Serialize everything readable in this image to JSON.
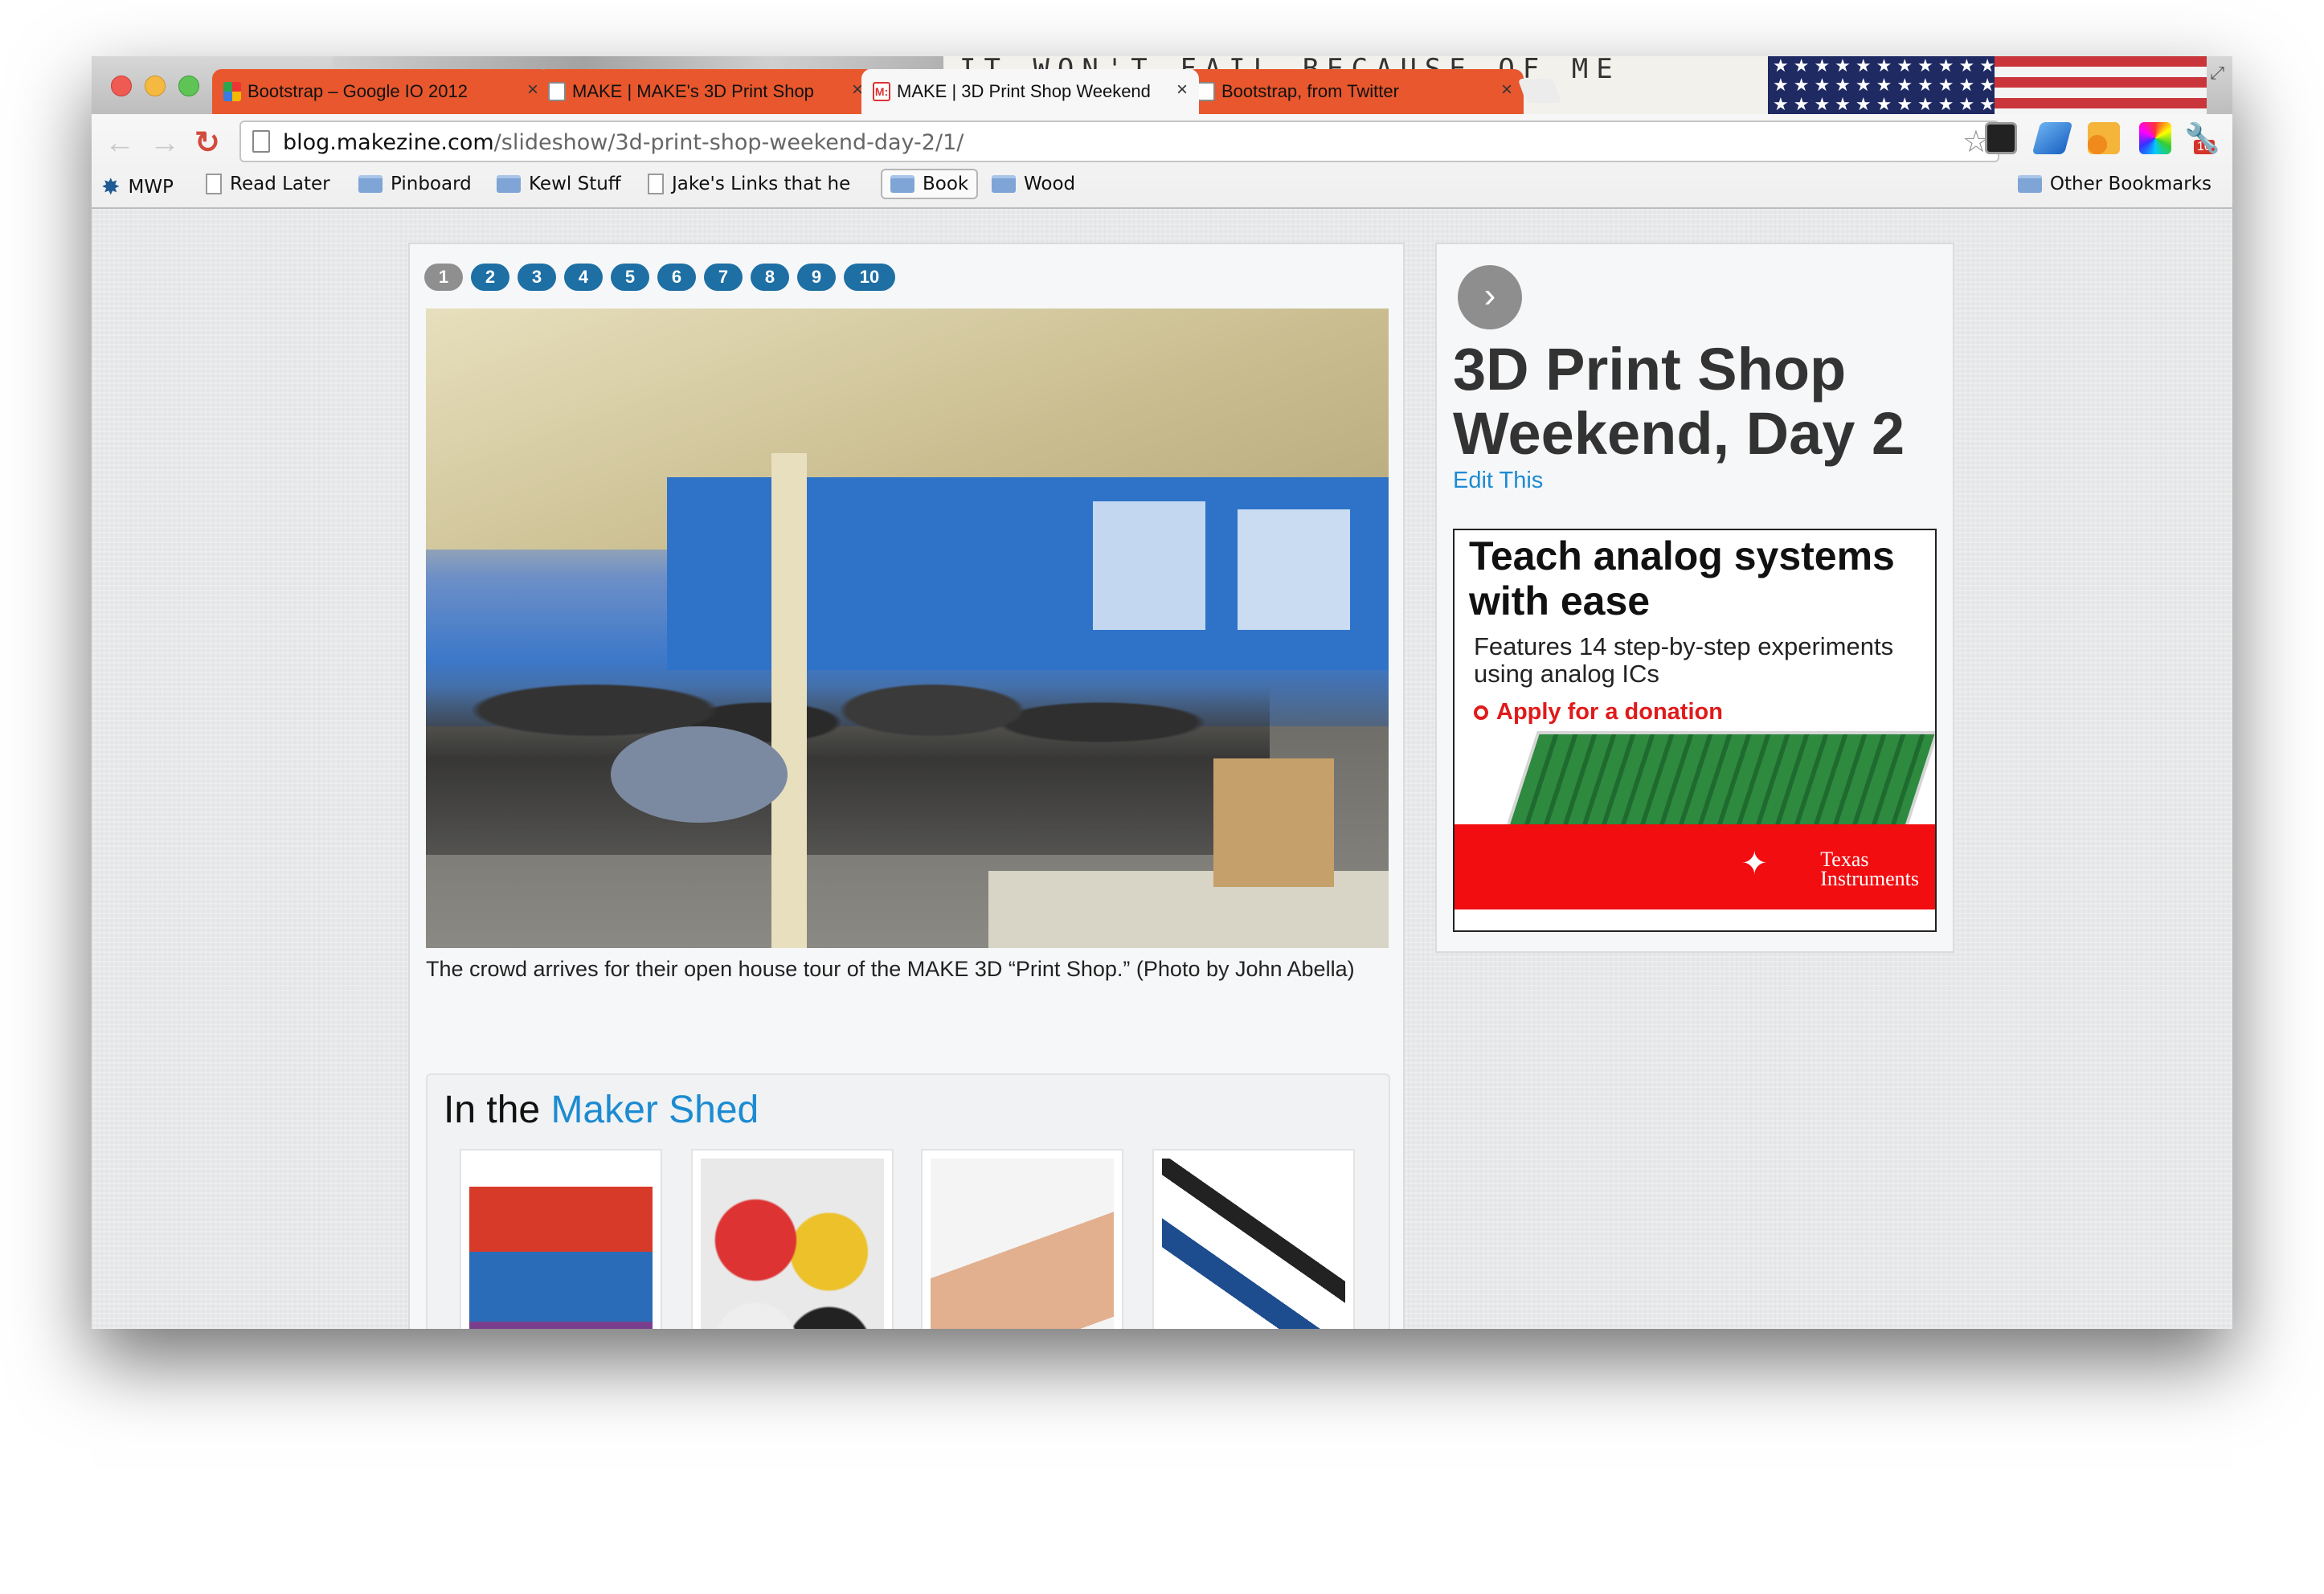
{
  "browser": {
    "titlebar_text": "IT WON'T FAIL BECAUSE OF ME",
    "tabs": [
      {
        "title": "Bootstrap – Google IO 2012",
        "close": "×"
      },
      {
        "title": "MAKE | MAKE's 3D Print Shop",
        "close": "×"
      },
      {
        "title": "MAKE | 3D Print Shop Weekend",
        "close": "×"
      },
      {
        "title": "Bootstrap, from Twitter",
        "close": "×"
      }
    ],
    "url_domain": "blog.makezine.com",
    "url_path": "/slideshow/3d-print-shop-weekend-day-2/1/",
    "extension_badge": "10",
    "bookmarks": [
      "MWP",
      "Read Later",
      "Pinboard",
      "Kewl Stuff",
      "Jake's Links that he",
      "Book",
      "Wood"
    ],
    "other_bookmarks": "Other Bookmarks"
  },
  "page": {
    "pager": [
      "1",
      "2",
      "3",
      "4",
      "5",
      "6",
      "7",
      "8",
      "9",
      "10"
    ],
    "current_page": "1",
    "caption": "The crowd arrives for their open house tour of the MAKE 3D “Print Shop.” (Photo by John Abella)",
    "shed": {
      "prefix": "In the",
      "highlight": "Maker Shed"
    },
    "next_arrow": "›",
    "title": "3D Print Shop Weekend, Day 2",
    "edit_link": "Edit This",
    "ad": {
      "headline": "Teach analog systems with ease",
      "body": "Features 14 step-by-step experiments using analog ICs",
      "cta": "Apply for a donation",
      "brand_line1": "Texas",
      "brand_line2": "Instruments"
    }
  },
  "colors": {
    "tab_orange": "#e8572d",
    "link_blue": "#1c8bd2",
    "pager_blue": "#1d6fa4",
    "ad_red": "#f10d10"
  },
  "icons": [
    "back-icon",
    "forward-icon",
    "reload-icon",
    "page-icon",
    "star-icon",
    "folder-icon",
    "document-icon",
    "next-arrow-icon"
  ]
}
